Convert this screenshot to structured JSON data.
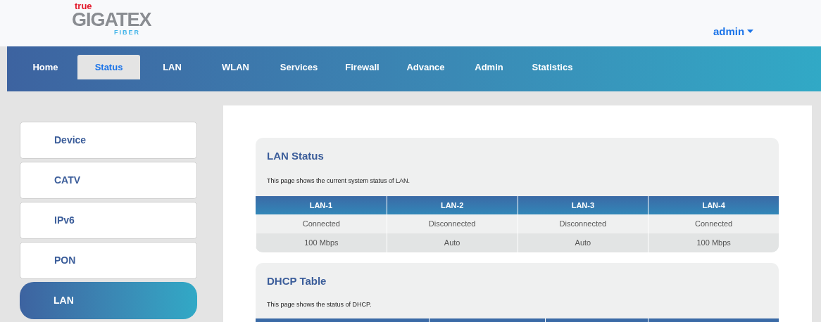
{
  "logo": {
    "brand": "true",
    "name": "GIGATEX",
    "sub": "FIBER"
  },
  "user_menu": {
    "label": "admin"
  },
  "nav": [
    {
      "label": "Home",
      "selected": false
    },
    {
      "label": "Status",
      "selected": true
    },
    {
      "label": "LAN",
      "selected": false
    },
    {
      "label": "WLAN",
      "selected": false
    },
    {
      "label": "Services",
      "selected": false
    },
    {
      "label": "Firewall",
      "selected": false
    },
    {
      "label": "Advance",
      "selected": false
    },
    {
      "label": "Admin",
      "selected": false
    },
    {
      "label": "Statistics",
      "selected": false
    }
  ],
  "sidebar": {
    "items": [
      {
        "label": "Device",
        "selected": false
      },
      {
        "label": "CATV",
        "selected": false
      },
      {
        "label": "IPv6",
        "selected": false
      },
      {
        "label": "PON",
        "selected": false
      },
      {
        "label": "LAN",
        "selected": true
      }
    ]
  },
  "lan_status": {
    "title": "LAN Status",
    "description": "This page shows the current system status of LAN.",
    "columns": [
      "LAN-1",
      "LAN-2",
      "LAN-3",
      "LAN-4"
    ],
    "rows": [
      [
        "Connected",
        "Disconnected",
        "Disconnected",
        "Connected"
      ],
      [
        "100 Mbps",
        "Auto",
        "Auto",
        "100 Mbps"
      ]
    ]
  },
  "dhcp_table": {
    "title": "DHCP Table",
    "description": "This page shows the status of DHCP."
  }
}
